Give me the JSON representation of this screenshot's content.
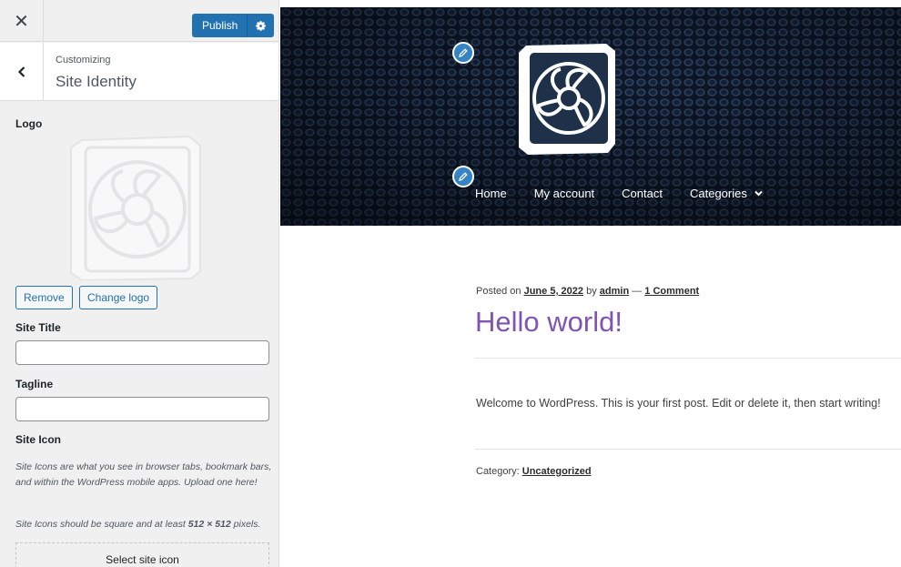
{
  "sidebar": {
    "close_glyph": "✕",
    "publish_label": "Publish",
    "breadcrumb": "Customizing",
    "section_title": "Site Identity",
    "logo_label": "Logo",
    "remove_label": "Remove",
    "change_logo_label": "Change logo",
    "site_title_label": "Site Title",
    "site_title_value": "",
    "tagline_label": "Tagline",
    "tagline_value": "",
    "site_icon_label": "Site Icon",
    "site_icon_desc": "Site Icons are what you see in browser tabs, bookmark bars, and within the WordPress mobile apps. Upload one here!",
    "site_icon_size_prefix": "Site Icons should be square and at least ",
    "site_icon_size_value": "512 × 512",
    "site_icon_size_suffix": " pixels.",
    "select_icon_label": "Select site icon",
    "icons": [
      "close-icon",
      "gear-icon",
      "chevron-left-icon",
      "fan-logo-icon"
    ]
  },
  "preview": {
    "nav": [
      "Home",
      "My account",
      "Contact",
      "Categories"
    ],
    "post": {
      "posted_on": "Posted on ",
      "date": "June 5, 2022",
      "by": " by ",
      "author": "admin",
      "sep": " — ",
      "comments": "1 Comment",
      "title": "Hello world!",
      "body": "Welcome to WordPress. This is your first post. Edit or delete it, then start writing!",
      "category_label": "Category: ",
      "category": "Uncategorized"
    }
  },
  "colors": {
    "accent": "#2271b1",
    "title": "#7f54b3",
    "shortcut": "#3582c4",
    "sidebar_bg": "#f0f0f1"
  }
}
